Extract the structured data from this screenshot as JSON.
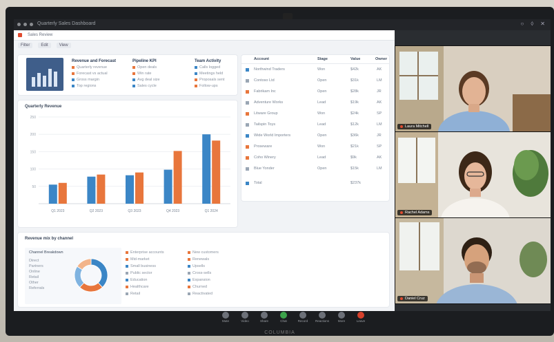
{
  "window": {
    "title": "Quarterly Sales Dashboard",
    "tab_title": "Sales Review",
    "right_icons": [
      "bell-icon",
      "share-icon",
      "close-icon"
    ]
  },
  "toolbar": {
    "items": [
      "Filter",
      "Edit",
      "View"
    ]
  },
  "summary_cards": [
    {
      "header": "Revenue and Forecast",
      "rows": [
        "Quarterly revenue",
        "Forecast vs actual",
        "Gross margin",
        "Top regions"
      ]
    },
    {
      "header": "Pipeline KPI",
      "rows": [
        "Open deals",
        "Win rate",
        "Avg deal size",
        "Sales cycle"
      ]
    },
    {
      "header": "Team Activity",
      "rows": [
        "Calls logged",
        "Meetings held",
        "Proposals sent",
        "Follow-ups"
      ]
    }
  ],
  "chart_data": {
    "type": "bar",
    "title": "Quarterly Revenue",
    "categories": [
      "Q1 2023",
      "Q2 2023",
      "Q3 2023",
      "Q4 2023",
      "Q1 2024"
    ],
    "series": [
      {
        "name": "",
        "color": "#3b86c6",
        "values": [
          55,
          78,
          82,
          98,
          200
        ]
      },
      {
        "name": "",
        "color": "#e8763c",
        "values": [
          60,
          84,
          90,
          152,
          182
        ]
      }
    ],
    "yticks": [
      50,
      100,
      150,
      200,
      250
    ],
    "ylim": [
      0,
      250
    ]
  },
  "table": {
    "headers": [
      "Account",
      "Stage",
      "Value",
      "Owner"
    ],
    "rows": [
      {
        "name": "Northwind Traders",
        "stage": "Won",
        "value": "$42k",
        "owner": "AK",
        "color": "#3b86c6"
      },
      {
        "name": "Contoso Ltd",
        "stage": "Open",
        "value": "$31k",
        "owner": "LM",
        "color": "#9aa6b4"
      },
      {
        "name": "Fabrikam Inc",
        "stage": "Open",
        "value": "$28k",
        "owner": "JR",
        "color": "#e8763c"
      },
      {
        "name": "Adventure Works",
        "stage": "Lead",
        "value": "$19k",
        "owner": "AK",
        "color": "#9aa6b4"
      },
      {
        "name": "Litware Group",
        "stage": "Won",
        "value": "$24k",
        "owner": "SP",
        "color": "#e8763c"
      },
      {
        "name": "Tailspin Toys",
        "stage": "Lead",
        "value": "$12k",
        "owner": "LM",
        "color": "#9aa6b4"
      },
      {
        "name": "Wide World Importers",
        "stage": "Open",
        "value": "$36k",
        "owner": "JR",
        "color": "#3b86c6"
      },
      {
        "name": "Proseware",
        "stage": "Won",
        "value": "$21k",
        "owner": "SP",
        "color": "#e8763c"
      },
      {
        "name": "Coho Winery",
        "stage": "Lead",
        "value": "$9k",
        "owner": "AK",
        "color": "#e8763c"
      },
      {
        "name": "Blue Yonder",
        "stage": "Open",
        "value": "$15k",
        "owner": "LM",
        "color": "#9aa6b4"
      },
      {
        "name": "Total",
        "stage": "",
        "value": "$237k",
        "owner": "",
        "color": "#3b86c6"
      }
    ]
  },
  "donut_card": {
    "header": "Revenue mix by channel",
    "legend_title": "Channel Breakdown",
    "left_rows": [
      "Direct",
      "Partners",
      "Online",
      "Retail",
      "Other",
      "Referrals"
    ],
    "slices": [
      {
        "value": 38,
        "color": "#3b86c6"
      },
      {
        "value": 24,
        "color": "#e8763c"
      },
      {
        "value": 22,
        "color": "#7fb3e0"
      },
      {
        "value": 16,
        "color": "#f2b48a"
      }
    ],
    "list_a": [
      "Enterprise accounts",
      "Mid-market",
      "Small business",
      "Public sector",
      "Education",
      "Healthcare",
      "Retail"
    ],
    "list_b": [
      "New customers",
      "Renewals",
      "Upsells",
      "Cross-sells",
      "Expansion",
      "Churned",
      "Reactivated"
    ]
  },
  "participants": [
    {
      "name": "Laura Mitchell"
    },
    {
      "name": "Rachel Adams"
    },
    {
      "name": "Daniel Cruz"
    }
  ],
  "dock": {
    "buttons": [
      {
        "label": "Mute",
        "icon": "mic-icon",
        "color": "#6c7078"
      },
      {
        "label": "Video",
        "icon": "video-icon",
        "color": "#6c7078"
      },
      {
        "label": "Share",
        "icon": "share-screen-icon",
        "color": "#6c7078"
      },
      {
        "label": "Chat",
        "icon": "chat-icon",
        "color": "#3ca24a"
      },
      {
        "label": "Record",
        "icon": "record-icon",
        "color": "#6c7078"
      },
      {
        "label": "Reactions",
        "icon": "reaction-icon",
        "color": "#6c7078"
      },
      {
        "label": "More",
        "icon": "more-icon",
        "color": "#6c7078"
      },
      {
        "label": "Leave",
        "icon": "leave-icon",
        "color": "#d6402b"
      }
    ]
  },
  "monitor_brand": "COLUMBIA"
}
